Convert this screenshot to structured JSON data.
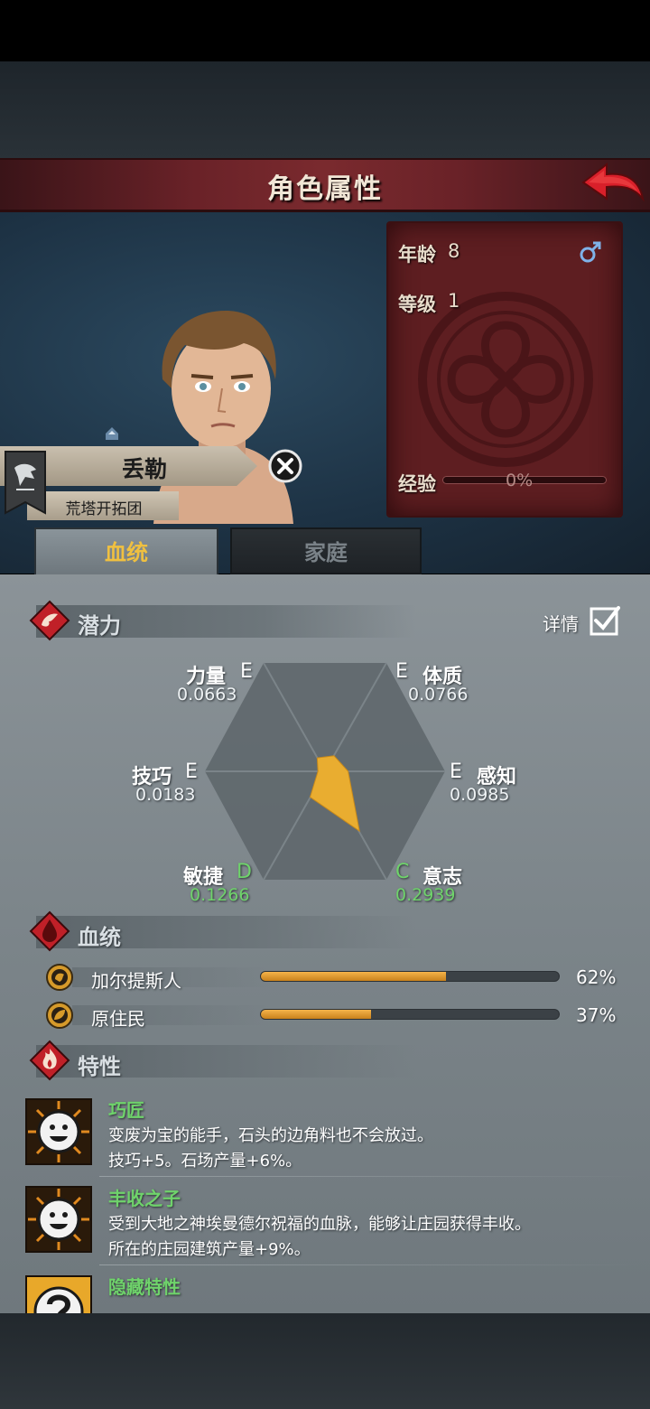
{
  "header": {
    "title": "角色属性"
  },
  "character": {
    "name": "丢勒",
    "guild": "荒塔开拓团",
    "age_label": "年龄",
    "age_value": "8",
    "level_label": "等级",
    "level_value": "1",
    "exp_label": "经验",
    "exp_value": "0%",
    "exp_fraction": 0,
    "gender_icon": "male-icon"
  },
  "tabs": [
    {
      "label": "血统",
      "active": true
    },
    {
      "label": "家庭",
      "active": false
    }
  ],
  "potential": {
    "title": "潜力",
    "detail_label": "详情",
    "detail_checked": true,
    "stats": [
      {
        "name": "力量",
        "grade": "E",
        "value": "0.0663"
      },
      {
        "name": "体质",
        "grade": "E",
        "value": "0.0766"
      },
      {
        "name": "感知",
        "grade": "E",
        "value": "0.0985"
      },
      {
        "name": "意志",
        "grade": "C",
        "value": "0.2939"
      },
      {
        "name": "敏捷",
        "grade": "D",
        "value": "0.1266"
      },
      {
        "name": "技巧",
        "grade": "E",
        "value": "0.0183"
      }
    ]
  },
  "bloodline": {
    "title": "血统",
    "items": [
      {
        "name": "加尔提斯人",
        "percent": "62%",
        "fraction": 0.62,
        "icon": "lion-crest-icon"
      },
      {
        "name": "原住民",
        "percent": "37%",
        "fraction": 0.37,
        "icon": "leaf-crest-icon"
      }
    ]
  },
  "traits": {
    "title": "特性",
    "items": [
      {
        "name": "巧匠",
        "desc1": "变废为宝的能手，石头的边角料也不会放过。",
        "desc2": "技巧+5。石场产量+6%。",
        "icon": "smiley-icon"
      },
      {
        "name": "丰收之子",
        "desc1": "受到大地之神埃曼德尔祝福的血脉，能够让庄园获得丰收。",
        "desc2": "所在的庄园建筑产量+9%。",
        "icon": "smiley-icon"
      },
      {
        "name": "隐藏特性",
        "desc1": "",
        "desc2": "",
        "icon": "question-mark-icon"
      }
    ]
  },
  "colors": {
    "accent_gold": "#f0c040",
    "trait_green": "#6fd36b",
    "panel_red": "#5e1e21"
  }
}
